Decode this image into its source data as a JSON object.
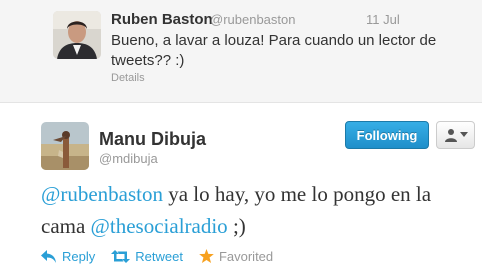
{
  "context_tweet": {
    "name": "Ruben Baston",
    "handle": "@rubenbaston",
    "time": "11 Jul",
    "text": "Bueno, a lavar a louza! Para cuando un lector de tweets?? :)",
    "details_label": "Details"
  },
  "main_tweet": {
    "name": "Manu Dibuja",
    "handle": "@mdibuja",
    "follow_label": "Following",
    "text_parts": {
      "mention1": "@rubenbaston",
      "text1": " ya lo hay, yo me lo pongo en la cama ",
      "mention2": "@thesocialradio",
      "text2": " ;)"
    },
    "actions": {
      "reply": "Reply",
      "retweet": "Retweet",
      "favorited": "Favorited"
    }
  },
  "icons": {
    "reply": "reply-arrow-icon",
    "retweet": "retweet-icon",
    "favorite": "star-icon",
    "user_menu": "user-icon"
  },
  "colors": {
    "link": "#2a9fd6",
    "follow_button": "#1f8fca",
    "favorite_star": "#f7a11f"
  }
}
